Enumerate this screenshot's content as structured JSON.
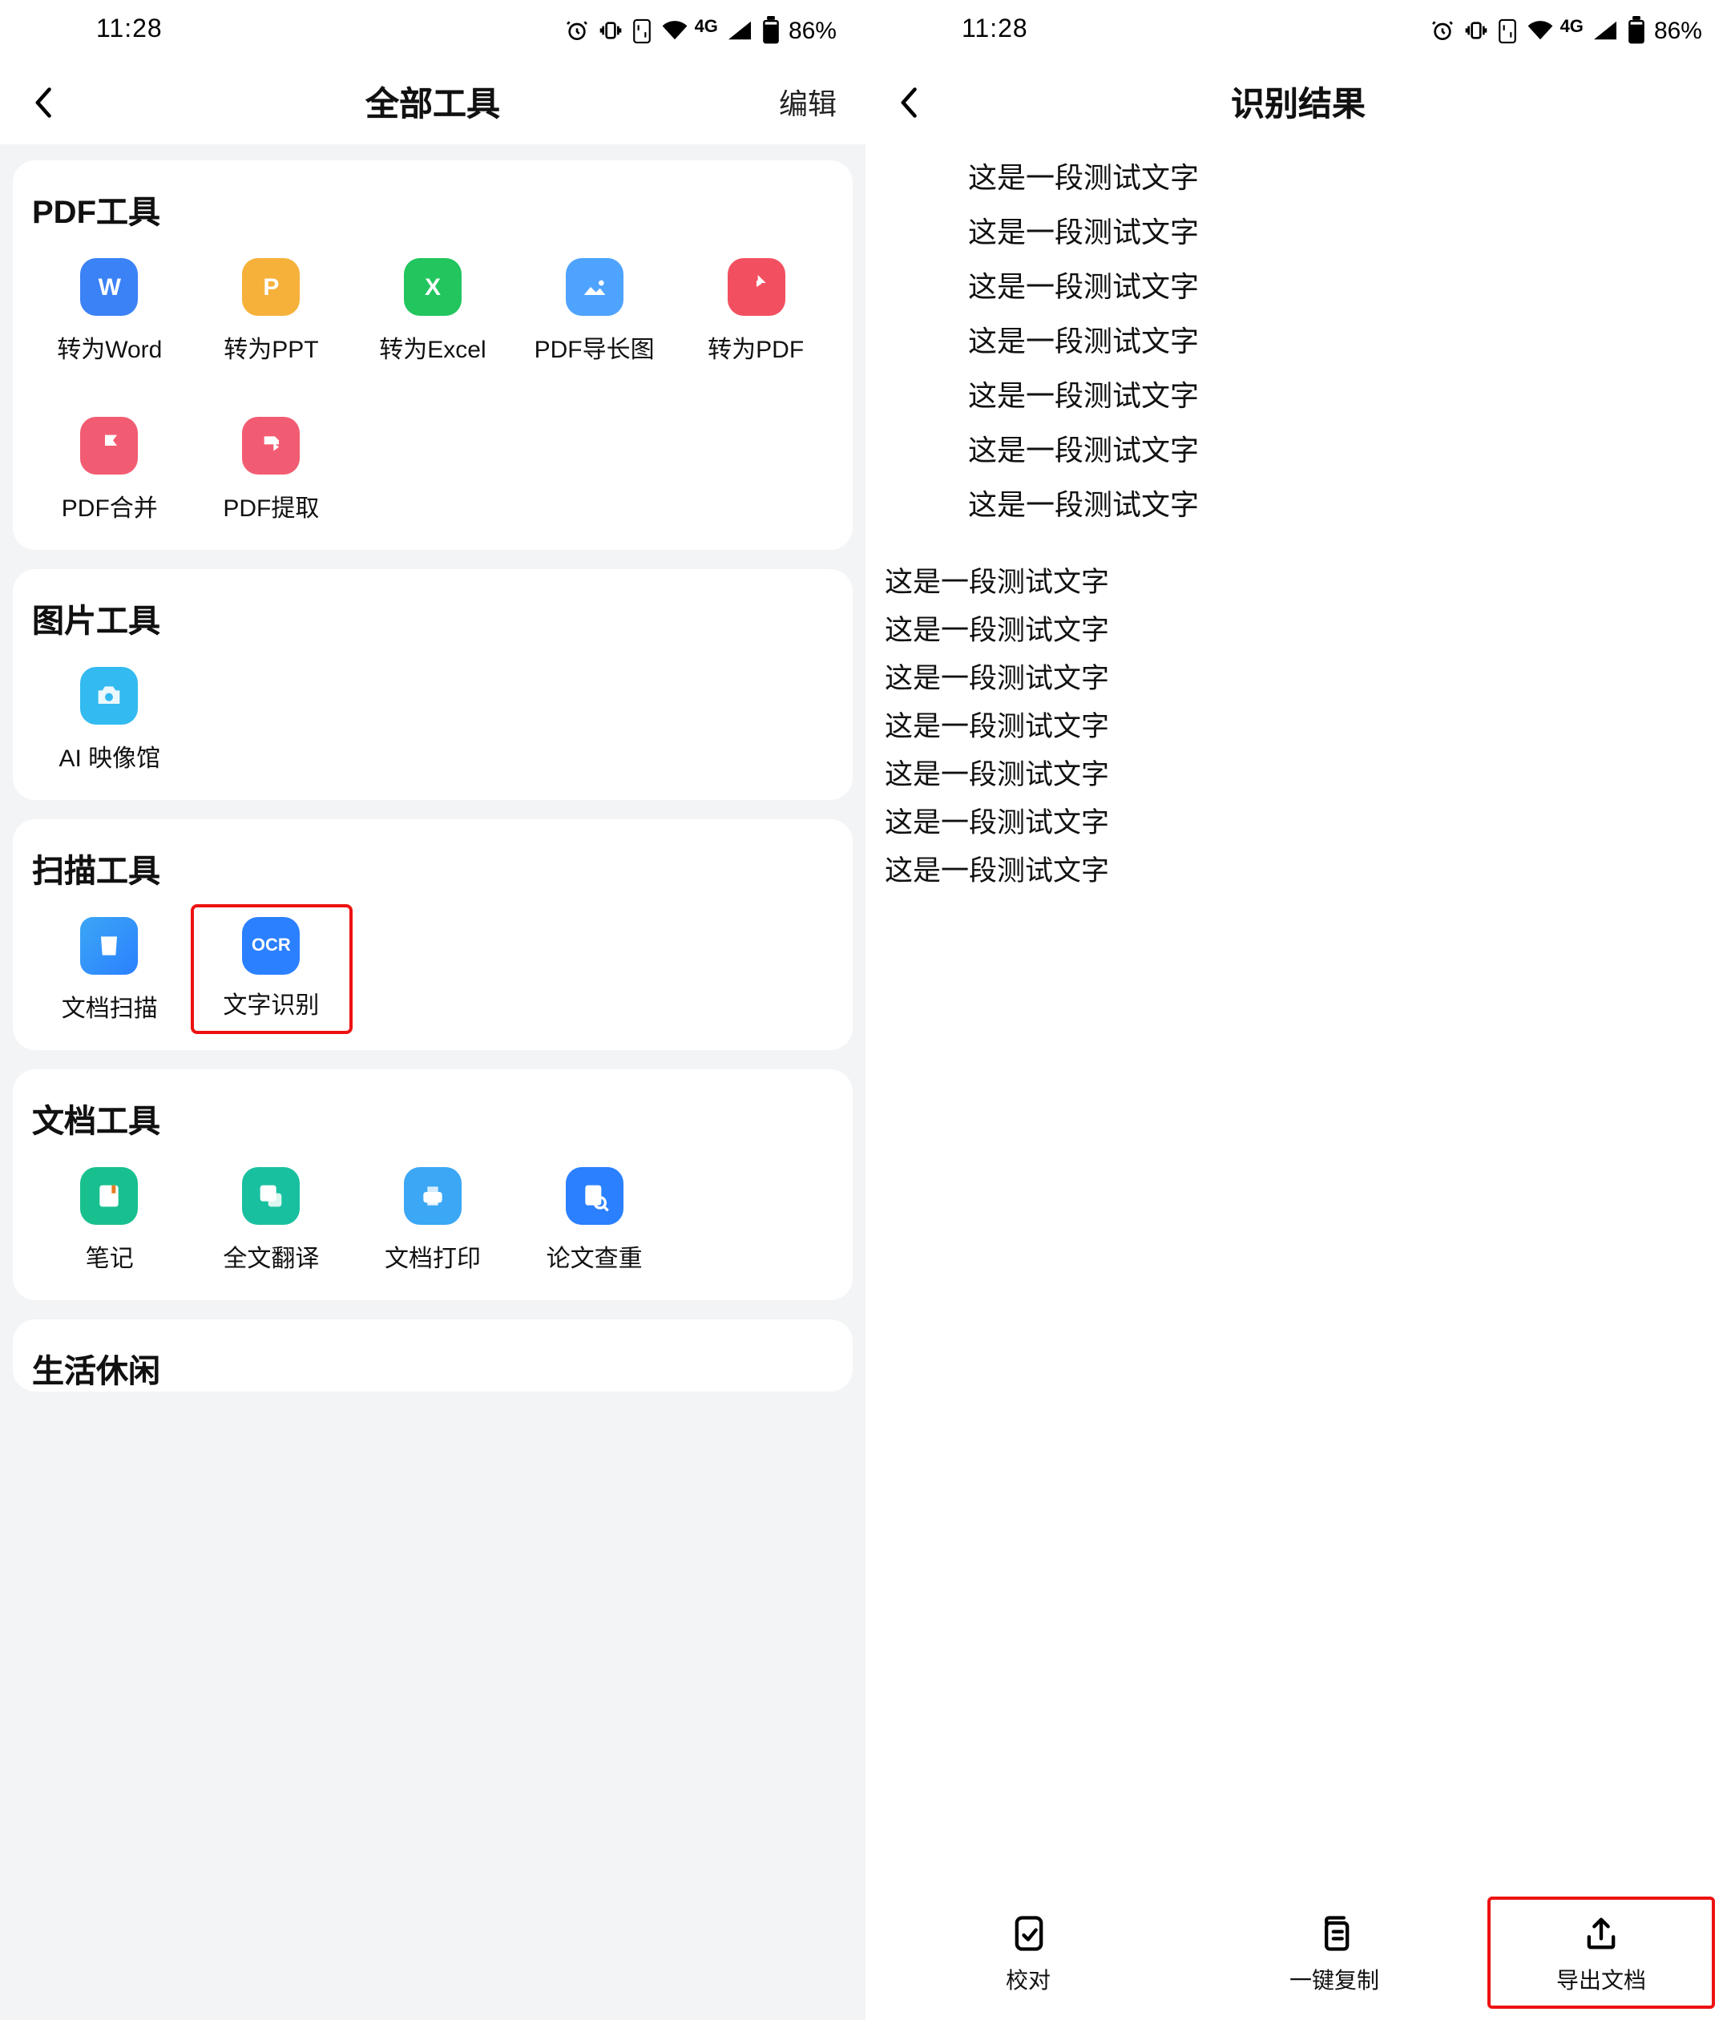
{
  "status": {
    "time": "11:28",
    "network": "4G",
    "battery_pct": "86%"
  },
  "left": {
    "title": "全部工具",
    "edit": "编辑",
    "sections": {
      "pdf": {
        "title": "PDF工具",
        "items": [
          "转为Word",
          "转为PPT",
          "转为Excel",
          "PDF导长图",
          "转为PDF",
          "PDF合并",
          "PDF提取"
        ]
      },
      "image": {
        "title": "图片工具",
        "items": [
          "AI 映像馆"
        ]
      },
      "scan": {
        "title": "扫描工具",
        "items": [
          "文档扫描",
          "文字识别"
        ]
      },
      "doc": {
        "title": "文档工具",
        "items": [
          "笔记",
          "全文翻译",
          "文档打印",
          "论文查重"
        ]
      },
      "life": {
        "title": "生活休闲"
      }
    }
  },
  "right": {
    "title": "识别结果",
    "lines_centered": [
      "这是一段测试文字",
      "这是一段测试文字",
      "这是一段测试文字",
      "这是一段测试文字",
      "这是一段测试文字",
      "这是一段测试文字",
      "这是一段测试文字"
    ],
    "lines_left": [
      "这是一段测试文字",
      "这是一段测试文字",
      "这是一段测试文字",
      "这是一段测试文字",
      "这是一段测试文字",
      "这是一段测试文字",
      "这是一段测试文字"
    ],
    "bottom": {
      "proof": "校对",
      "copy": "一键复制",
      "export": "导出文档"
    }
  }
}
